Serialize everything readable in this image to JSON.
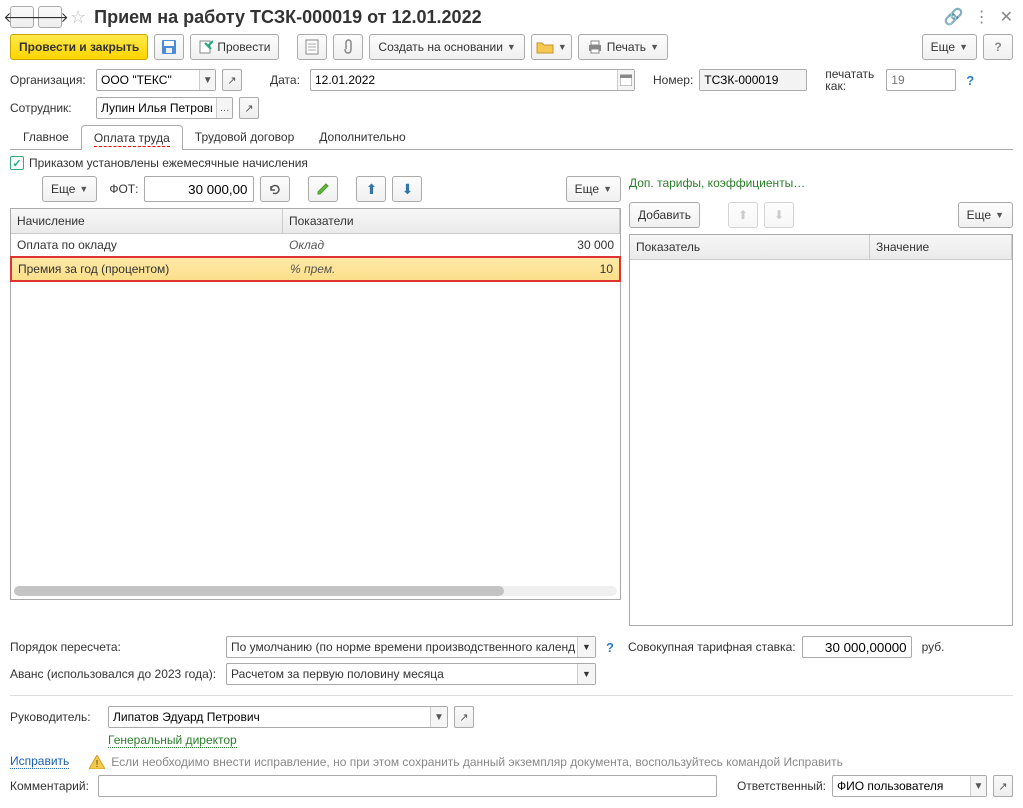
{
  "header": {
    "title": "Прием на работу ТСЗК-000019 от 12.01.2022"
  },
  "toolbar": {
    "post_close": "Провести и закрыть",
    "post": "Провести",
    "create_based": "Создать на основании",
    "print": "Печать",
    "more": "Еще"
  },
  "fields": {
    "org_label": "Организация:",
    "org_value": "ООО \"ТЕКС\"",
    "date_label": "Дата:",
    "date_value": "12.01.2022",
    "number_label": "Номер:",
    "number_value": "ТСЗК-000019",
    "print_as_label": "печатать как:",
    "print_as_value": "19",
    "employee_label": "Сотрудник:",
    "employee_value": "Лупин Илья Петрович"
  },
  "tabs": {
    "main": "Главное",
    "payment": "Оплата труда",
    "contract": "Трудовой договор",
    "additional": "Дополнительно"
  },
  "pane": {
    "checkbox_label": "Приказом установлены ежемесячные начисления",
    "more": "Еще",
    "fot_label": "ФОТ:",
    "fot_value": "30 000,00"
  },
  "grid": {
    "col1": "Начисление",
    "col2": "Показатели",
    "rows": [
      {
        "name": "Оплата по окладу",
        "param": "Оклад",
        "value": "30 000"
      },
      {
        "name": "Премия за год (процентом)",
        "param": "% прем.",
        "value": "10"
      }
    ]
  },
  "right": {
    "link": "Доп. тарифы, коэффициенты…",
    "add": "Добавить",
    "more": "Еще",
    "col1": "Показатель",
    "col2": "Значение"
  },
  "below": {
    "recalc_label": "Порядок пересчета:",
    "recalc_value": "По умолчанию (по норме времени производственного календ",
    "rate_label": "Совокупная тарифная ставка:",
    "rate_value": "30 000,00000",
    "rate_unit": "руб.",
    "advance_label": "Аванс (использовался до 2023 года):",
    "advance_value": "Расчетом за первую половину месяца"
  },
  "footer": {
    "manager_label": "Руководитель:",
    "manager_value": "Липатов Эдуард Петрович",
    "position": "Генеральный директор",
    "fix": "Исправить",
    "fix_note": "Если необходимо внести исправление, но при этом сохранить данный экземпляр документа, воспользуйтесь командой Исправить",
    "comment_label": "Комментарий:",
    "responsible_label": "Ответственный:",
    "responsible_value": "ФИО пользователя"
  }
}
